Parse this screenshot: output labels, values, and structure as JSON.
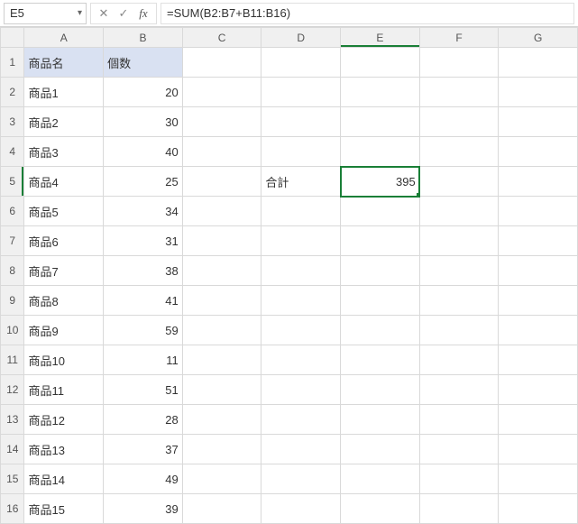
{
  "nameBox": "E5",
  "formula": "=SUM(B2:B7+B11:B16)",
  "columns": [
    "A",
    "B",
    "C",
    "D",
    "E",
    "F",
    "G"
  ],
  "headers": {
    "A1": "商品名",
    "B1": "個数"
  },
  "rows": [
    {
      "n": 1,
      "a": "商品名",
      "b": "個数",
      "header": true
    },
    {
      "n": 2,
      "a": "商品1",
      "b": 20
    },
    {
      "n": 3,
      "a": "商品2",
      "b": 30
    },
    {
      "n": 4,
      "a": "商品3",
      "b": 40
    },
    {
      "n": 5,
      "a": "商品4",
      "b": 25,
      "d": "合計",
      "e": 395
    },
    {
      "n": 6,
      "a": "商品5",
      "b": 34
    },
    {
      "n": 7,
      "a": "商品6",
      "b": 31
    },
    {
      "n": 8,
      "a": "商品7",
      "b": 38
    },
    {
      "n": 9,
      "a": "商品8",
      "b": 41
    },
    {
      "n": 10,
      "a": "商品9",
      "b": 59
    },
    {
      "n": 11,
      "a": "商品10",
      "b": 11
    },
    {
      "n": 12,
      "a": "商品11",
      "b": 51
    },
    {
      "n": 13,
      "a": "商品12",
      "b": 28
    },
    {
      "n": 14,
      "a": "商品13",
      "b": 37
    },
    {
      "n": 15,
      "a": "商品14",
      "b": 49
    },
    {
      "n": 16,
      "a": "商品15",
      "b": 39
    }
  ],
  "selected": {
    "row": 5,
    "col": "E"
  }
}
